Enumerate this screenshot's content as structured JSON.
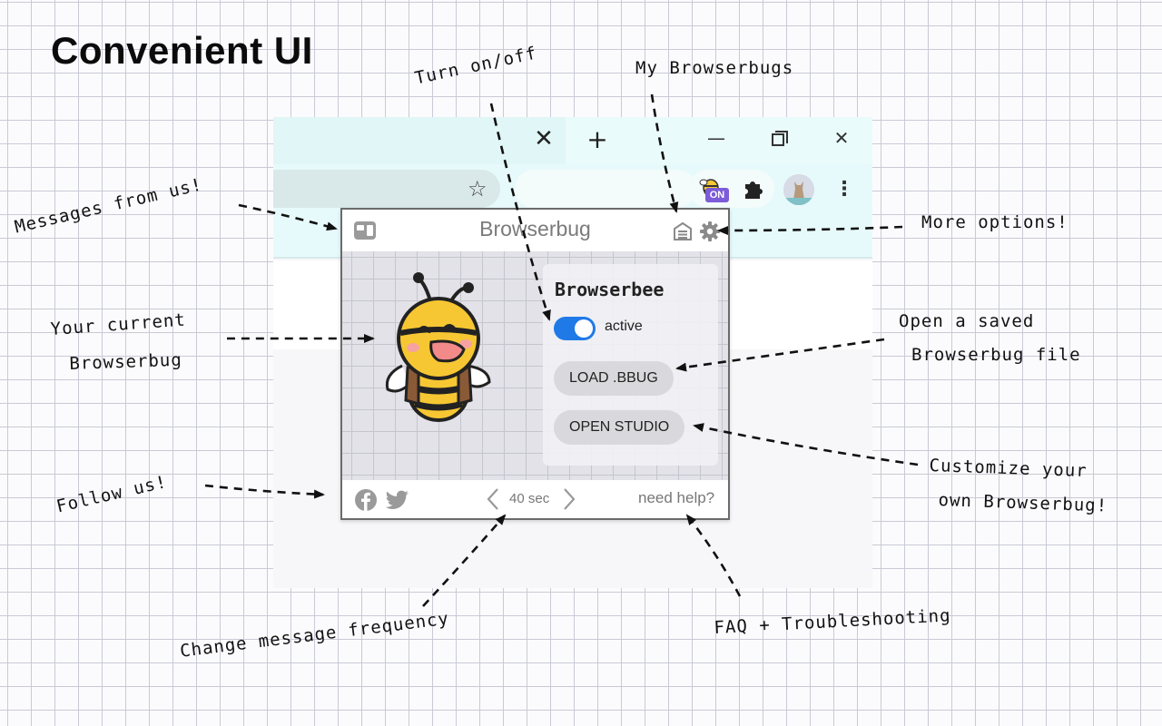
{
  "page": {
    "title": "Convenient UI"
  },
  "browser": {
    "tab_close_glyph": "✕",
    "new_tab_glyph": "+",
    "window_controls": {
      "minimize": "—",
      "close": "✕"
    },
    "extension_badge": "ON"
  },
  "popup": {
    "title": "Browserbug",
    "bug_name": "Browserbee",
    "toggle": {
      "label": "active",
      "on": true
    },
    "load_button": "LOAD .BBUG",
    "studio_button": "OPEN STUDIO",
    "frequency": "40 sec",
    "help_link": "need help?",
    "colors": {
      "toggle": "#1f7ae8",
      "badge": "#7c5cd8",
      "bee": "#f6c733"
    }
  },
  "annotations": {
    "turn_on_off": "Turn on/off",
    "my_browserbugs": "My Browserbugs",
    "messages": "Messages from us!",
    "more_options": "More options!",
    "current_bug_line1": "Your current",
    "current_bug_line2": "Browserbug",
    "open_saved_line1": "Open a saved",
    "open_saved_line2": "Browserbug file",
    "customize_line1": "Customize your",
    "customize_line2": "own Browserbug!",
    "follow_us": "Follow us!",
    "change_frequency": "Change message frequency",
    "faq": "FAQ + Troubleshooting"
  },
  "icons": [
    "star-icon",
    "puzzle-icon",
    "avatar",
    "kebab-menu-icon",
    "message-icon",
    "bugs-icon",
    "gear-icon",
    "facebook-icon",
    "twitter-icon",
    "chevron-left-icon",
    "chevron-right-icon"
  ]
}
